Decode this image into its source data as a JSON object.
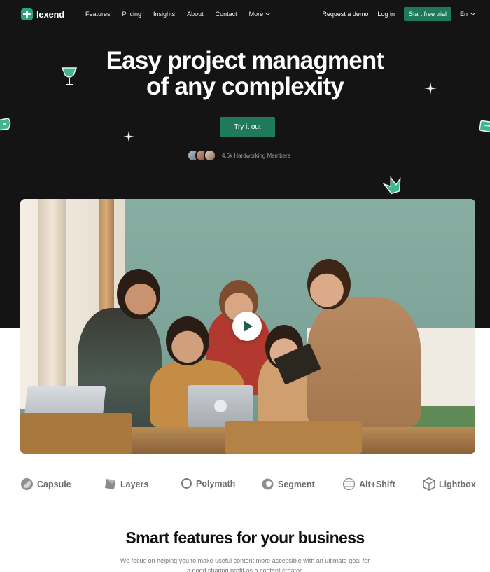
{
  "brand": {
    "name": "lexend",
    "accent": "#1f7a5c",
    "logo_icon": "plus-cross-logo-icon"
  },
  "nav": {
    "links": [
      "Features",
      "Pricing",
      "Insights",
      "About",
      "Contact"
    ],
    "more_label": "More",
    "request_demo": "Request a demo",
    "login": "Log in",
    "free_trial": "Start free trial",
    "language": "En"
  },
  "hero": {
    "title_line1": "Easy project managment",
    "title_line2": "of any complexity",
    "cta": "Try it out",
    "members_text": "4.6k Hardworking Members",
    "background": "#141414"
  },
  "video": {
    "play_icon": "play-icon"
  },
  "partners": [
    {
      "name": "Capsule",
      "icon": "capsule-icon"
    },
    {
      "name": "Layers",
      "icon": "layers-icon"
    },
    {
      "name": "Polymath",
      "icon": "polymath-icon"
    },
    {
      "name": "Segment",
      "icon": "segment-icon"
    },
    {
      "name": "Alt+Shift",
      "icon": "altshift-icon"
    },
    {
      "name": "Lightbox",
      "icon": "lightbox-icon"
    }
  ],
  "features": {
    "title": "Smart features for your business",
    "description": "We focus on helping you to make useful content more accessible with an ultimate goal for a good sharing profit as a content creator."
  }
}
